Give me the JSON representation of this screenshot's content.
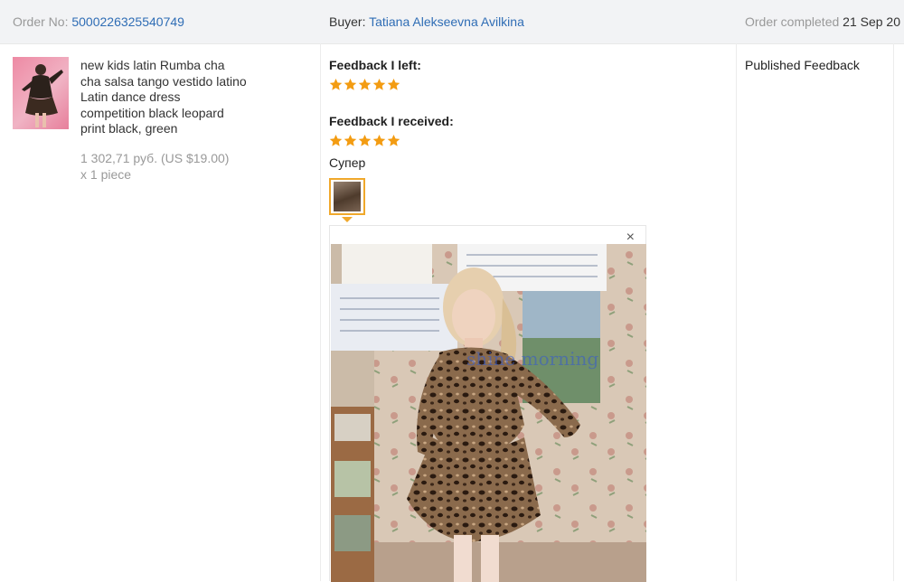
{
  "order": {
    "number_label": "Order No:",
    "number_value": "5000226325540749",
    "buyer_label": "Buyer:",
    "buyer_value": "Tatiana Alekseevna Avilkina",
    "status_label": "Order completed",
    "status_value": "21 Sep 20"
  },
  "product": {
    "title": "new kids latin Rumba cha cha salsa tango vestido latino Latin dance dress competition black leopard print black, green",
    "price": "1 302,71 руб. (US $19.00)",
    "quantity": "x 1 piece"
  },
  "feedback": {
    "left_label": "Feedback I left:",
    "left_rating": 5,
    "received_label": "Feedback I received:",
    "received_rating": 5,
    "received_text": "Супер",
    "close_symbol": "×",
    "photo_watermark": "shine morning"
  },
  "status_column": {
    "text": "Published Feedback"
  },
  "colors": {
    "link": "#2f6db5",
    "star": "#f39c12",
    "thumb_border": "#f0a82b"
  },
  "icons": [
    "star-icon",
    "close-icon"
  ]
}
